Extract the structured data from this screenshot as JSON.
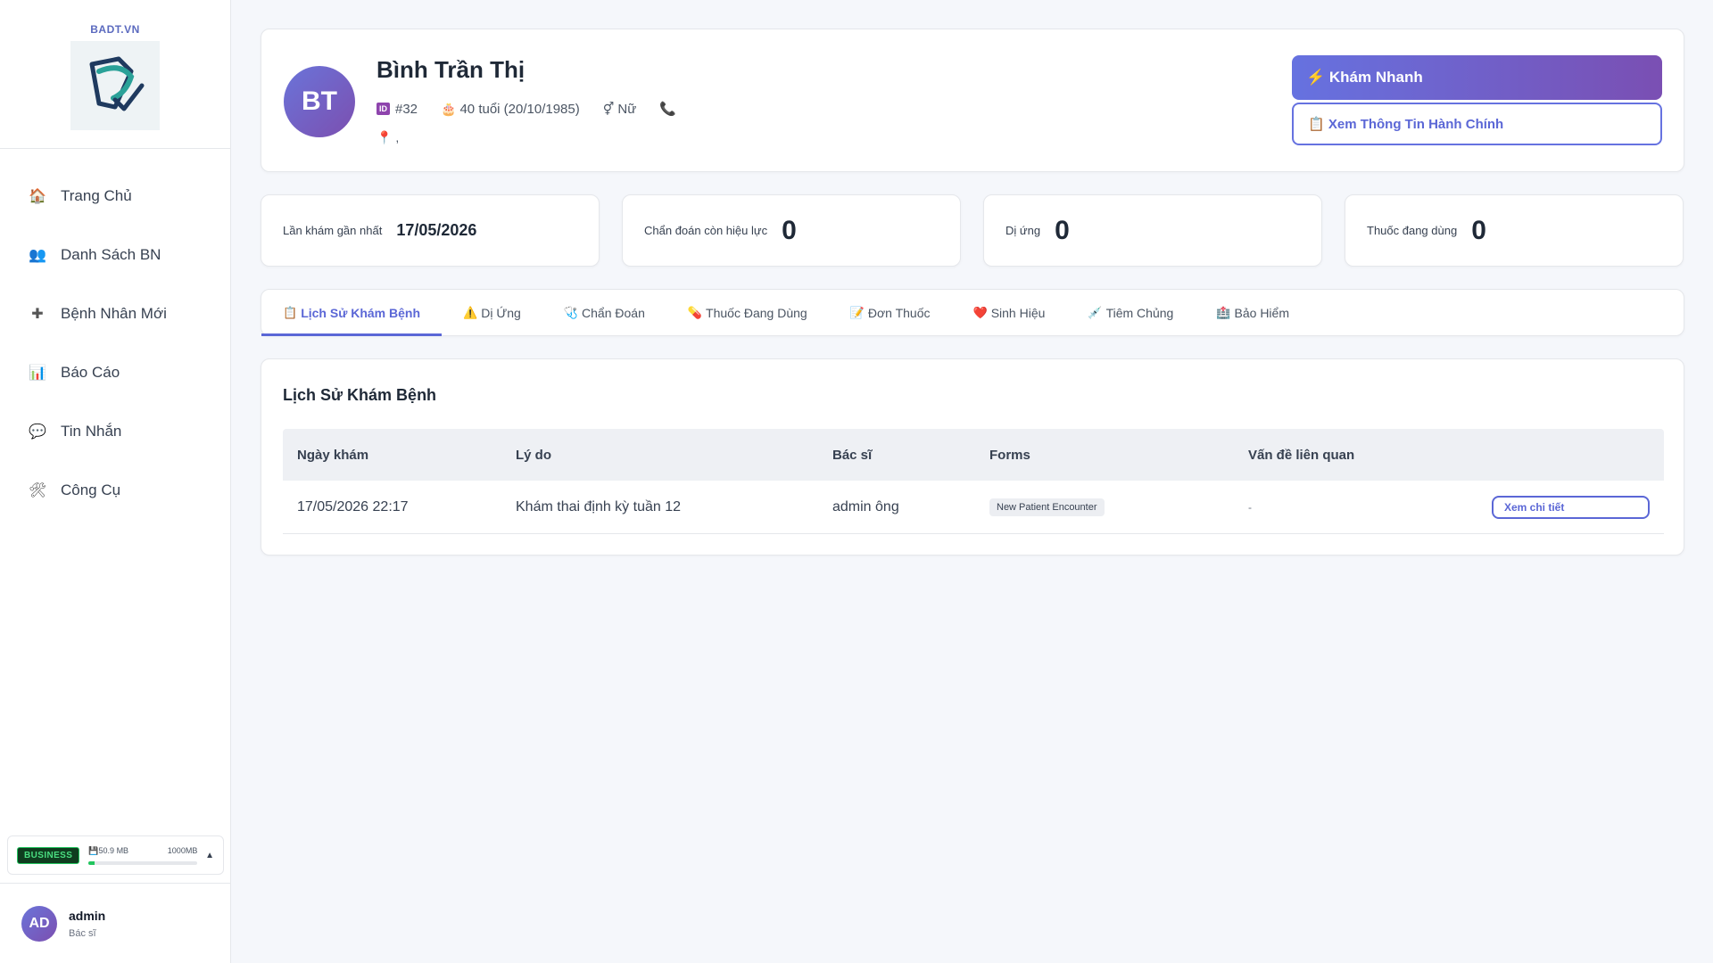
{
  "brand": {
    "name": "BADT.VN"
  },
  "sidebar": {
    "items": [
      {
        "label": "Trang Chủ",
        "icon": "home-icon",
        "glyph": "🏠"
      },
      {
        "label": "Danh Sách BN",
        "icon": "users-icon",
        "glyph": "👥"
      },
      {
        "label": "Bệnh Nhân Mới",
        "icon": "plus-icon",
        "glyph": "✚"
      },
      {
        "label": "Báo Cáo",
        "icon": "chart-icon",
        "glyph": "📊"
      },
      {
        "label": "Tin Nhắn",
        "icon": "message-icon",
        "glyph": "💬"
      },
      {
        "label": "Công Cụ",
        "icon": "tools-icon",
        "glyph": "🛠"
      }
    ],
    "plan": {
      "badge": "BUSINESS",
      "used": "50.9 MB",
      "total": "1000MB",
      "used_fraction": 0.051,
      "caret": "▲"
    },
    "user": {
      "initials": "AD",
      "name": "admin",
      "role": "Bác sĩ"
    }
  },
  "patient": {
    "initials": "BT",
    "name": "Bình Trần Thị",
    "id": "#32",
    "age": "40 tuổi (20/10/1985)",
    "gender": "Nữ",
    "address": ","
  },
  "actions": {
    "quick_exam": "⚡ Khám Nhanh",
    "admin_info": "📋 Xem Thông Tin Hành Chính"
  },
  "stats": [
    {
      "label": "Lần khám gần nhất",
      "value": "17/05/2026"
    },
    {
      "label": "Chẩn đoán còn hiệu lực",
      "value": "0"
    },
    {
      "label": "Dị ứng",
      "value": "0"
    },
    {
      "label": "Thuốc đang dùng",
      "value": "0"
    }
  ],
  "tabs": [
    {
      "label": "Lịch Sử Khám Bệnh",
      "glyph": "📋",
      "active": true
    },
    {
      "label": "Dị Ứng",
      "glyph": "⚠️"
    },
    {
      "label": "Chẩn Đoán",
      "glyph": "🩺"
    },
    {
      "label": "Thuốc Đang Dùng",
      "glyph": "💊"
    },
    {
      "label": "Đơn Thuốc",
      "glyph": "📝"
    },
    {
      "label": "Sinh Hiệu",
      "glyph": "❤️"
    },
    {
      "label": "Tiêm Chủng",
      "glyph": "💉"
    },
    {
      "label": "Bảo Hiểm",
      "glyph": "🏥"
    }
  ],
  "history": {
    "title": "Lịch Sử Khám Bệnh",
    "columns": [
      "Ngày khám",
      "Lý do",
      "Bác sĩ",
      "Forms",
      "Vấn đề liên quan",
      ""
    ],
    "rows": [
      {
        "date": "17/05/2026 22:17",
        "reason": "Khám thai định kỳ tuần 12",
        "doctor": "admin ông",
        "form": "New Patient Encounter",
        "issues": "-",
        "action": "Xem chi tiết"
      }
    ]
  },
  "colors": {
    "accent": "#5b67d6",
    "accent_gradient_end": "#7a4fb3",
    "plan_badge": "#0f3d1f"
  }
}
